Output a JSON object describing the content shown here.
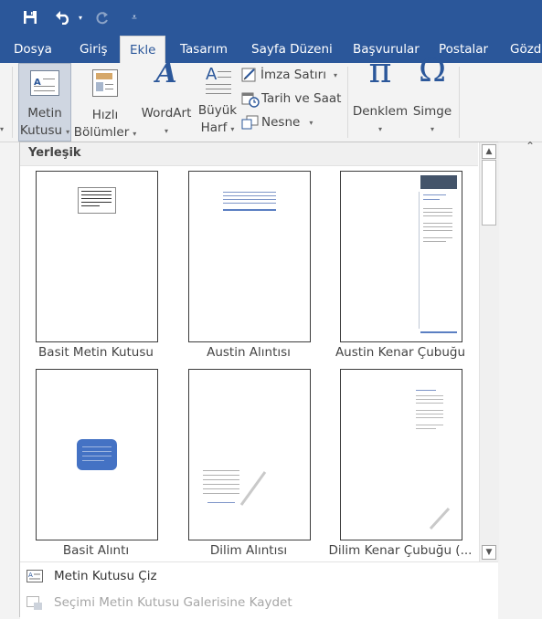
{
  "quick_access": {
    "save_icon": "save-icon",
    "undo_icon": "undo-icon",
    "redo_icon": "redo-icon",
    "customize_icon": "customize-qat-icon"
  },
  "tabs": [
    {
      "label": "Dosya"
    },
    {
      "label": "Giriş"
    },
    {
      "label": "Ekle",
      "active": true
    },
    {
      "label": "Tasarım"
    },
    {
      "label": "Sayfa Düzeni"
    },
    {
      "label": "Başvurular"
    },
    {
      "label": "Postalar"
    },
    {
      "label": "Gözd"
    }
  ],
  "ribbon": {
    "text_box": {
      "line1": "Metin",
      "line2": "Kutusu"
    },
    "quick_parts": {
      "line1": "Hızlı",
      "line2": "Bölümler"
    },
    "wordart": {
      "label": "WordArt"
    },
    "drop_cap": {
      "line1": "Büyük",
      "line2": "Harf"
    },
    "signature_line": {
      "label": "İmza Satırı"
    },
    "date_time": {
      "label": "Tarih ve Saat"
    },
    "object": {
      "label": "Nesne"
    },
    "equation": {
      "label": "Denklem",
      "glyph": "π"
    },
    "symbol": {
      "label": "Simge",
      "glyph": "Ω"
    }
  },
  "gallery": {
    "section_title": "Yerleşik",
    "items": [
      {
        "caption": "Basit Metin Kutusu"
      },
      {
        "caption": "Austin Alıntısı"
      },
      {
        "caption": "Austin Kenar Çubuğu"
      },
      {
        "caption": "Basit Alıntı"
      },
      {
        "caption": "Dilim Alıntısı"
      },
      {
        "caption": "Dilim Kenar Çubuğu (..."
      }
    ],
    "footer": [
      {
        "label": "Metin Kutusu Çiz",
        "enabled": true
      },
      {
        "label": "Seçimi Metin Kutusu Galerisine Kaydet",
        "enabled": false
      }
    ]
  },
  "colors": {
    "brand": "#2b579a",
    "ribbon_bg": "#f3f3f3",
    "accent_blue": "#4472c4"
  }
}
